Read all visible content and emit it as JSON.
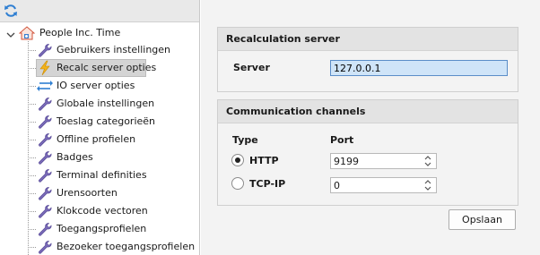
{
  "tree": {
    "root_label": "People Inc. Time",
    "items": [
      {
        "label": "Gebruikers instellingen",
        "icon": "wrench-icon"
      },
      {
        "label": "Recalc server opties",
        "icon": "lightning-icon",
        "selected": true
      },
      {
        "label": "IO server opties",
        "icon": "arrows-exchange-icon"
      },
      {
        "label": "Globale instellingen",
        "icon": "wrench-icon"
      },
      {
        "label": "Toeslag categorieën",
        "icon": "wrench-icon"
      },
      {
        "label": "Offline profielen",
        "icon": "wrench-icon"
      },
      {
        "label": "Badges",
        "icon": "wrench-icon"
      },
      {
        "label": "Terminal definities",
        "icon": "wrench-icon"
      },
      {
        "label": "Urensoorten",
        "icon": "wrench-icon"
      },
      {
        "label": "Klokcode vectoren",
        "icon": "wrench-icon"
      },
      {
        "label": "Toegangsprofielen",
        "icon": "wrench-icon"
      },
      {
        "label": "Bezoeker toegangsprofielen",
        "icon": "wrench-icon"
      }
    ]
  },
  "recalc": {
    "title": "Recalculation server",
    "server_label": "Server",
    "server_value": "127.0.0.1"
  },
  "comm": {
    "title": "Communication channels",
    "type_header": "Type",
    "port_header": "Port",
    "channels": [
      {
        "name": "HTTP",
        "port": "9199",
        "selected": true
      },
      {
        "name": "TCP-IP",
        "port": "0",
        "selected": false
      }
    ]
  },
  "save_label": "Opslaan",
  "colors": {
    "wrench": "#7a6bb8",
    "lightning": "#f2b21b",
    "refresh": "#2f7fd2"
  }
}
